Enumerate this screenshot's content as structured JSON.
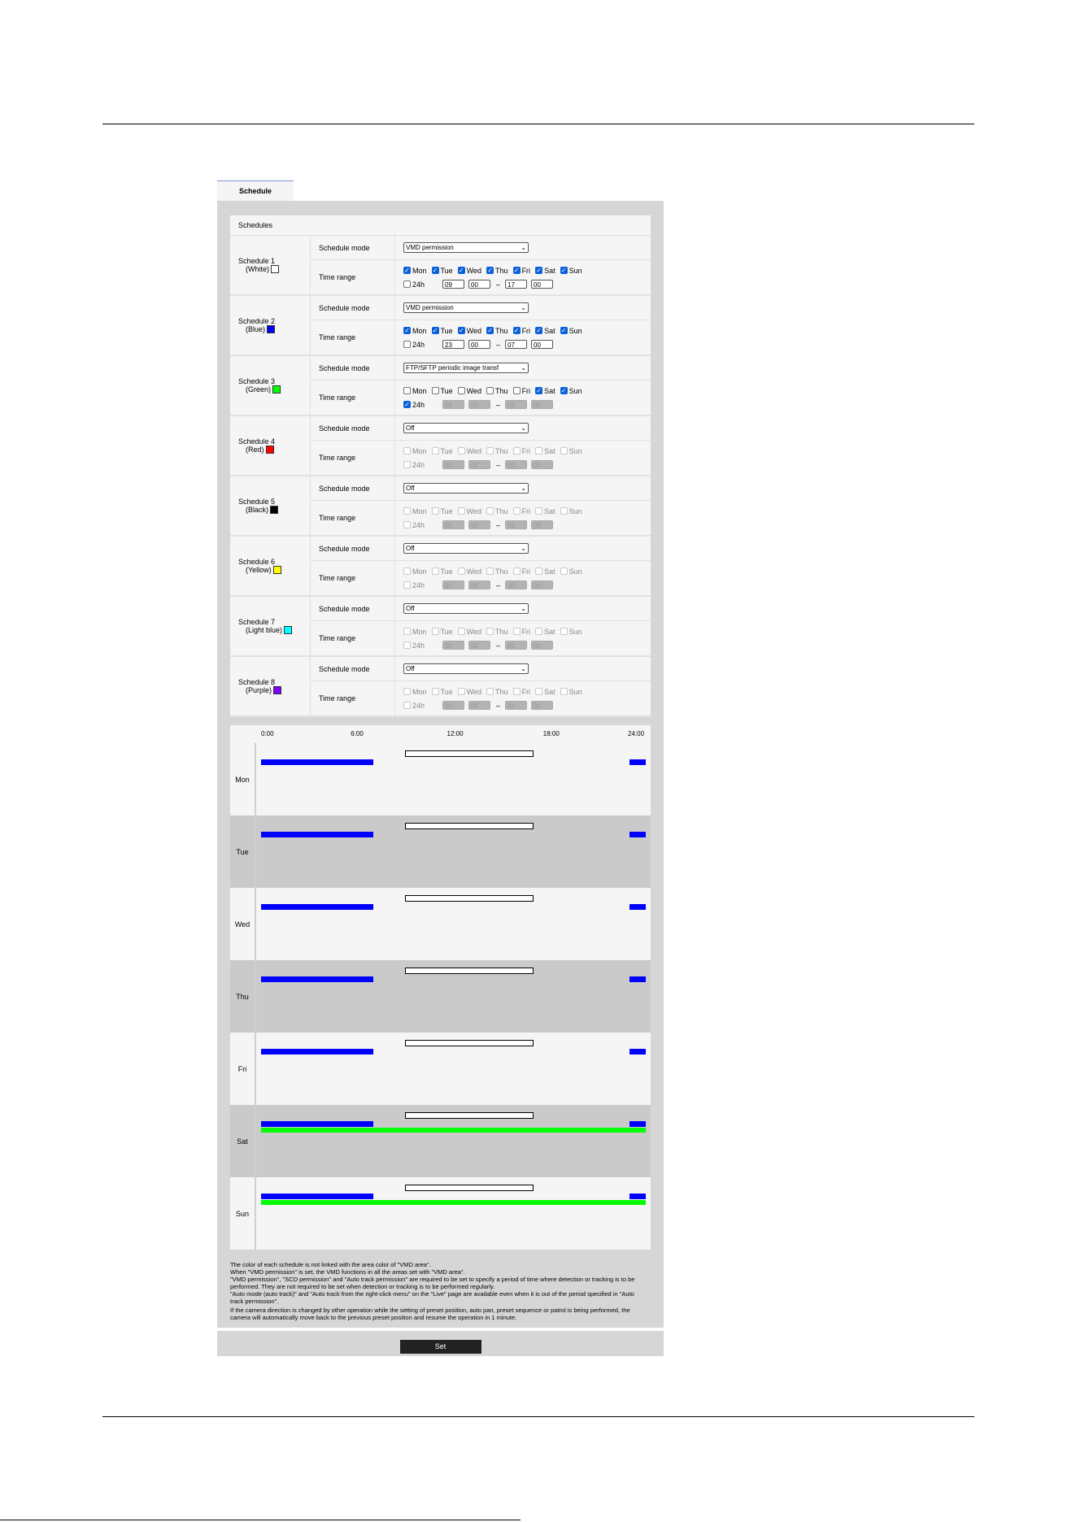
{
  "tab": "Schedule",
  "section_title": "Schedules",
  "labels": {
    "mode": "Schedule mode",
    "time": "Time range",
    "h24": "24h",
    "dash": "–"
  },
  "day_names": [
    "Mon",
    "Tue",
    "Wed",
    "Thu",
    "Fri",
    "Sat",
    "Sun"
  ],
  "schedules": [
    {
      "name": "Schedule 1",
      "color_label": "(White)",
      "color": "#ffffff",
      "mode": "VMD permission",
      "days": [
        true,
        true,
        true,
        true,
        true,
        true,
        true
      ],
      "h24": false,
      "start_h": "09",
      "start_m": "00",
      "end_h": "17",
      "end_m": "00",
      "enabled": true
    },
    {
      "name": "Schedule 2",
      "color_label": "(Blue)",
      "color": "#0000ff",
      "mode": "VMD permission",
      "days": [
        true,
        true,
        true,
        true,
        true,
        true,
        true
      ],
      "h24": false,
      "start_h": "23",
      "start_m": "00",
      "end_h": "07",
      "end_m": "00",
      "enabled": true
    },
    {
      "name": "Schedule 3",
      "color_label": "(Green)",
      "color": "#00ff00",
      "mode": "FTP/SFTP periodic image transf",
      "days": [
        false,
        false,
        false,
        false,
        false,
        true,
        true
      ],
      "h24": true,
      "start_h": "00",
      "start_m": "00",
      "end_h": "00",
      "end_m": "00",
      "enabled": true
    },
    {
      "name": "Schedule 4",
      "color_label": "(Red)",
      "color": "#ff0000",
      "mode": "Off",
      "days": [
        false,
        false,
        false,
        false,
        false,
        false,
        false
      ],
      "h24": false,
      "start_h": "00",
      "start_m": "00",
      "end_h": "00",
      "end_m": "00",
      "enabled": false
    },
    {
      "name": "Schedule 5",
      "color_label": "(Black)",
      "color": "#000000",
      "mode": "Off",
      "days": [
        false,
        false,
        false,
        false,
        false,
        false,
        false
      ],
      "h24": false,
      "start_h": "00",
      "start_m": "00",
      "end_h": "00",
      "end_m": "00",
      "enabled": false
    },
    {
      "name": "Schedule 6",
      "color_label": "(Yellow)",
      "color": "#ffff00",
      "mode": "Off",
      "days": [
        false,
        false,
        false,
        false,
        false,
        false,
        false
      ],
      "h24": false,
      "start_h": "00",
      "start_m": "00",
      "end_h": "00",
      "end_m": "00",
      "enabled": false
    },
    {
      "name": "Schedule 7",
      "color_label": "(Light blue)",
      "color": "#00ffff",
      "mode": "Off",
      "days": [
        false,
        false,
        false,
        false,
        false,
        false,
        false
      ],
      "h24": false,
      "start_h": "00",
      "start_m": "00",
      "end_h": "00",
      "end_m": "00",
      "enabled": false
    },
    {
      "name": "Schedule 8",
      "color_label": "(Purple)",
      "color": "#8000ff",
      "mode": "Off",
      "days": [
        false,
        false,
        false,
        false,
        false,
        false,
        false
      ],
      "h24": false,
      "start_h": "00",
      "start_m": "00",
      "end_h": "00",
      "end_m": "00",
      "enabled": false
    }
  ],
  "timeline": {
    "hour_labels": [
      "0:00",
      "6:00",
      "12:00",
      "18:00",
      "24:00"
    ],
    "days": [
      "Mon",
      "Tue",
      "Wed",
      "Thu",
      "Fri",
      "Sat",
      "Sun"
    ],
    "segments": [
      {
        "color": "#0000ff",
        "start": 0,
        "end": 7,
        "days": [
          "Mon",
          "Tue",
          "Wed",
          "Thu",
          "Fri",
          "Sat",
          "Sun"
        ]
      },
      {
        "color": "#ffffff",
        "start": 9,
        "end": 17,
        "days": [
          "Mon",
          "Tue",
          "Wed",
          "Thu",
          "Fri",
          "Sat",
          "Sun"
        ]
      },
      {
        "color": "#0000ff",
        "start": 23,
        "end": 24,
        "days": [
          "Mon",
          "Tue",
          "Wed",
          "Thu",
          "Fri",
          "Sat",
          "Sun"
        ]
      },
      {
        "color": "#00ff00",
        "start": 0,
        "end": 24,
        "days": [
          "Sat",
          "Sun"
        ]
      }
    ]
  },
  "notes": [
    "The color of each schedule is not linked with the area color of \"VMD area\".",
    "When \"VMD permission\" is set, the VMD functions in all the areas set with \"VMD area\".",
    "\"VMD permission\", \"SCD permission\" and \"Auto track permission\" are required to be set to specify a period of time where detection or tracking is to be performed. They are not required to be set when detection or tracking is to be performed regularly.",
    "\"Auto mode (auto track)\" and \"Auto track from the right-click menu\" on the \"Live\" page are available even when it is out of the period specified in \"Auto track permission\".",
    "If the camera direction is changed by other operation while the setting of preset position, auto pan, preset sequence or patrol is being performed, the camera will automatically move back to the previous preset position and resume the operation in 1 minute."
  ],
  "set_button": "Set"
}
